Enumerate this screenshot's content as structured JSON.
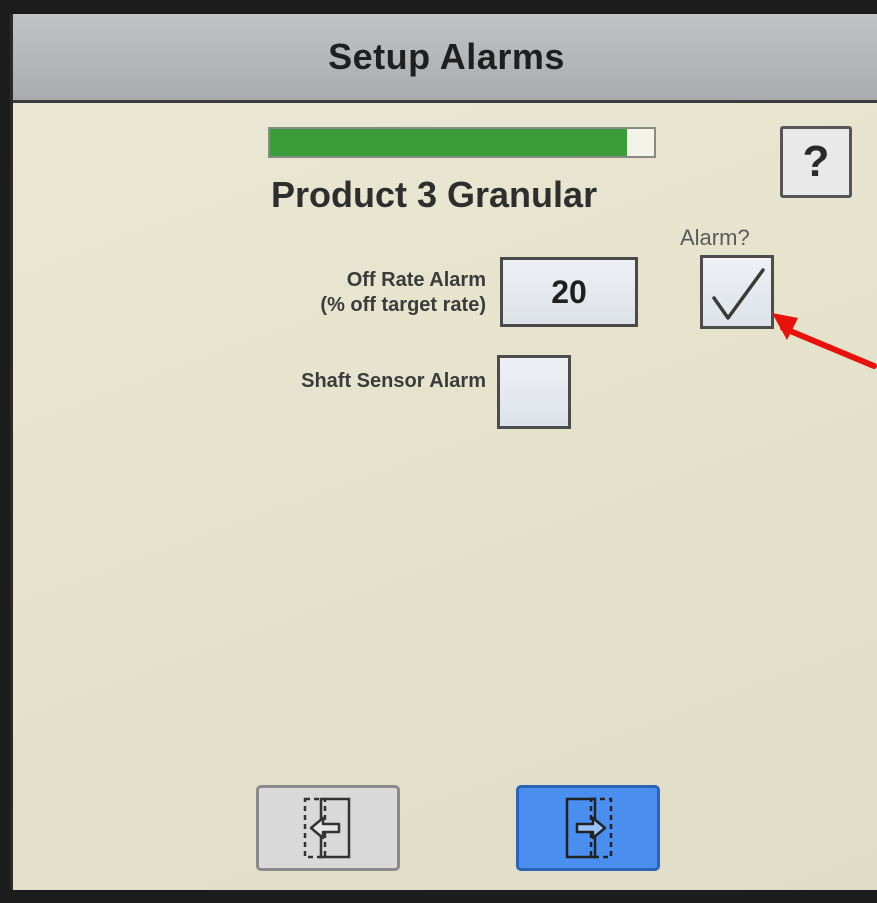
{
  "title": "Setup Alarms",
  "progress_fraction": 0.93,
  "product_name": "Product 3 Granular",
  "help_label": "?",
  "alarm_column_header": "Alarm?",
  "off_rate_alarm": {
    "label_line1": "Off Rate Alarm",
    "label_line2": "(% off target rate)",
    "value": "20",
    "alarm_enabled": true
  },
  "shaft_sensor_alarm": {
    "label": "Shaft Sensor Alarm",
    "enabled": false
  },
  "colors": {
    "progress": "#3a9d3a",
    "next_button": "#4a8ff0",
    "annotation_arrow": "#e8120c"
  },
  "icons": {
    "back": "exit-left-icon",
    "next": "exit-right-icon"
  }
}
